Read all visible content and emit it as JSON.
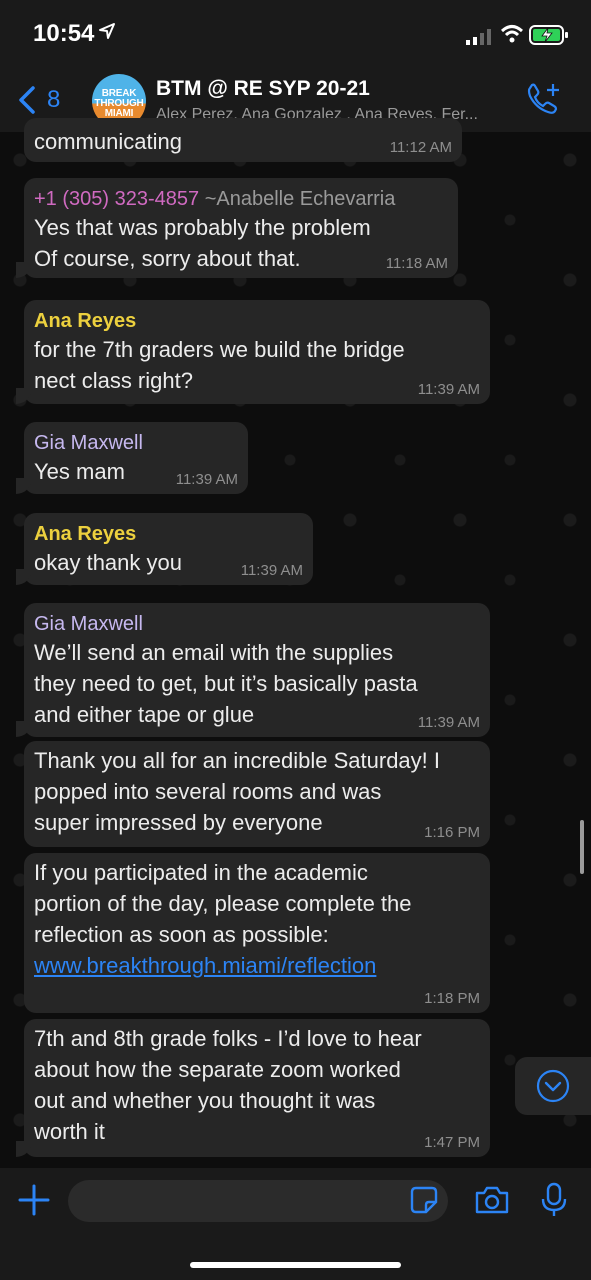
{
  "status_bar": {
    "time": "10:54",
    "icons": [
      "location-arrow-icon",
      "cellular-signal-icon",
      "wifi-icon",
      "battery-charging-icon"
    ]
  },
  "header": {
    "back_count": "8",
    "avatar_text": [
      "BREAK",
      "THROUGH",
      "MIAMI"
    ],
    "title": "BTM @ RE SYP 20-21",
    "members": "Alex Perez, Ana Gonzalez , Ana Reyes, Fer..."
  },
  "messages": [
    {
      "text": "communicating",
      "time": "11:12 AM"
    },
    {
      "sender_phone": "+1 (305) 323-4857",
      "sender_alias": "~Anabelle Echevarria",
      "lines": [
        "Yes that was probably the problem",
        "Of course, sorry about that."
      ],
      "time": "11:18 AM"
    },
    {
      "sender": "Ana Reyes",
      "lines": [
        "for the 7th graders we build the bridge",
        "nect class right?"
      ],
      "time": "11:39 AM"
    },
    {
      "sender": "Gia Maxwell",
      "lines": [
        "Yes mam"
      ],
      "time": "11:39 AM"
    },
    {
      "sender": "Ana Reyes",
      "lines": [
        "okay thank you"
      ],
      "time": "11:39 AM"
    },
    {
      "sender": "Gia Maxwell",
      "lines": [
        "We’ll send an email with the supplies",
        "they need to get, but it’s basically pasta",
        "and either tape or glue"
      ],
      "time": "11:39 AM"
    },
    {
      "lines": [
        "Thank you all for an incredible Saturday! I",
        "popped into several rooms and was",
        "super impressed by everyone"
      ],
      "time": "1:16 PM"
    },
    {
      "lines": [
        "If you participated in the academic",
        "portion of the day, please complete the",
        "reflection as soon as possible:"
      ],
      "link": "www.breakthrough.miami/reflection",
      "time": "1:18 PM"
    },
    {
      "lines": [
        "7th and 8th grade folks - I’d love to hear",
        "about how the separate zoom worked",
        "out and whether you thought it was",
        "worth it"
      ],
      "time": "1:47 PM"
    }
  ],
  "input": {
    "placeholder": "",
    "value": ""
  },
  "colors": {
    "accent": "#2c84f5",
    "bubble": "#262626",
    "sender_yellow": "#ecd03e",
    "sender_purple": "#c6b8ef",
    "sender_pink": "#d06ac1"
  }
}
